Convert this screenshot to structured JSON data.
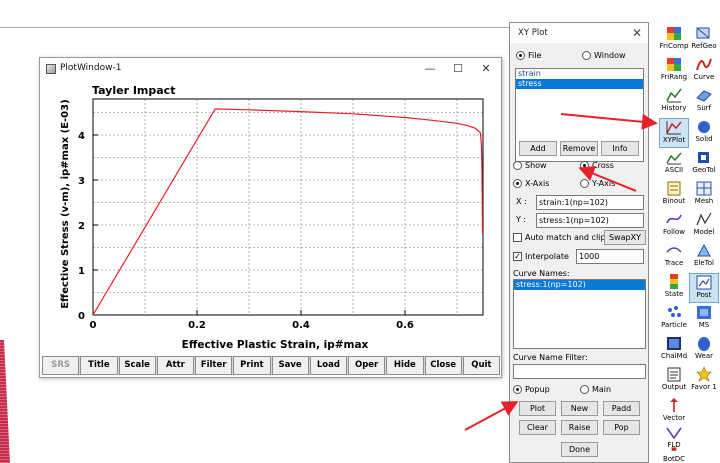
{
  "plot_window": {
    "title": "PlotWindow-1",
    "minimize": "—",
    "maximize": "☐",
    "close": "✕",
    "toolbar": [
      "SRS",
      "Title",
      "Scale",
      "Attr",
      "Filter",
      "Print",
      "Save",
      "Load",
      "Oper",
      "Hide",
      "Close",
      "Quit"
    ]
  },
  "chart_data": {
    "type": "line",
    "title": "Tayler Impact",
    "xlabel": "Effective Plastic Strain, ip#max",
    "ylabel": "Effective Stress (v-m), ip#max (E-03)",
    "xlim": [
      0,
      0.75
    ],
    "ylim": [
      0,
      4.8
    ],
    "x_ticks": [
      "0",
      "0.2",
      "0.4",
      "0.6"
    ],
    "x_tick_values": [
      0,
      0.2,
      0.4,
      0.6
    ],
    "y_ticks": [
      "0",
      "1",
      "2",
      "3",
      "4"
    ],
    "y_tick_values": [
      0,
      1,
      2,
      3,
      4
    ],
    "grid": true,
    "series": [
      {
        "color": "#e8202a",
        "x": [
          0,
          0.235,
          0.3,
          0.4,
          0.5,
          0.6,
          0.65,
          0.7,
          0.72,
          0.735,
          0.745,
          0.747,
          0.748,
          0.749
        ],
        "y": [
          0,
          4.58,
          4.56,
          4.52,
          4.47,
          4.39,
          4.33,
          4.26,
          4.21,
          4.15,
          4.05,
          3.8,
          3.2,
          1.8
        ]
      }
    ]
  },
  "xy_plot": {
    "title": "XY Plot",
    "close": "✕",
    "source": {
      "file": "File",
      "window": "Window",
      "selected": "file"
    },
    "files": [
      "strain",
      "stress"
    ],
    "selected_file": "stress",
    "buttons": {
      "add": "Add",
      "remove": "Remove",
      "info": "Info"
    },
    "show_cross": {
      "show": "Show",
      "cross": "Cross",
      "selected": "cross"
    },
    "axis": {
      "x": "X-Axis",
      "y": "Y-Axis",
      "selected": "x"
    },
    "x_label": "X :",
    "x_value": "strain:1(np=102)",
    "y_label": "Y :",
    "y_value": "stress:1(np=102)",
    "auto_match": "Auto match and clip",
    "swap": "SwapXY",
    "interpolate": "Interpolate",
    "interpolate_value": "1000",
    "curve_names_label": "Curve Names:",
    "curves": [
      "stress:1(np=102)"
    ],
    "filter_label": "Curve Name Filter:",
    "filter_value": "",
    "display": {
      "popup": "Popup",
      "main": "Main",
      "selected": "popup"
    },
    "actions": {
      "plot": "Plot",
      "new": "New",
      "padd": "Padd",
      "clear": "Clear",
      "raise": "Raise",
      "pop": "Pop",
      "done": "Done"
    }
  },
  "toolbar_right": [
    {
      "label": "FriComp",
      "icon": "cube-icon"
    },
    {
      "label": "RefGeo",
      "icon": "geometry-icon"
    },
    {
      "label": "FriRang",
      "icon": "cube-icon"
    },
    {
      "label": "Curve",
      "icon": "curve-icon"
    },
    {
      "label": "History",
      "icon": "history-icon"
    },
    {
      "label": "Surf",
      "icon": "surface-icon"
    },
    {
      "label": "XYPlot",
      "icon": "xyplot-icon"
    },
    {
      "label": "Solid",
      "icon": "solid-icon"
    },
    {
      "label": "ASCII",
      "icon": "ascii-icon"
    },
    {
      "label": "GeoTol",
      "icon": "geotol-icon"
    },
    {
      "label": "Binout",
      "icon": "binout-icon"
    },
    {
      "label": "Mesh",
      "icon": "mesh-icon"
    },
    {
      "label": "Follow",
      "icon": "follow-icon"
    },
    {
      "label": "Model",
      "icon": "model-icon"
    },
    {
      "label": "Trace",
      "icon": "trace-icon"
    },
    {
      "label": "EleTol",
      "icon": "eletol-icon"
    },
    {
      "label": "State",
      "icon": "state-icon"
    },
    {
      "label": "Post",
      "icon": "post-icon"
    },
    {
      "label": "Particle",
      "icon": "particle-icon"
    },
    {
      "label": "MS",
      "icon": "ms-icon"
    },
    {
      "label": "ChaiMd",
      "icon": "chaimd-icon"
    },
    {
      "label": "Wear",
      "icon": "wear-icon"
    },
    {
      "label": "Output",
      "icon": "output-icon"
    },
    {
      "label": "Favor 1",
      "icon": "favor-icon"
    },
    {
      "label": "Vector",
      "icon": "vector-icon"
    },
    {
      "label": "FLD",
      "icon": "fld-icon"
    },
    {
      "label": "BotDC",
      "icon": "botdc-icon"
    }
  ],
  "colors": {
    "annotation_arrow": "#e8202a",
    "selection": "#0a78d7"
  }
}
